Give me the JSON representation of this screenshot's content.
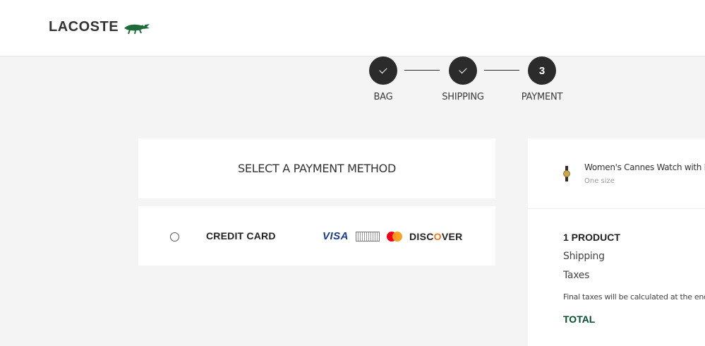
{
  "header": {
    "brand": "LACOSTE",
    "logo_icon": "crocodile-icon"
  },
  "stepper": {
    "steps": [
      {
        "label": "BAG",
        "status": "done",
        "icon": "check-icon"
      },
      {
        "label": "SHIPPING",
        "status": "done",
        "icon": "check-icon"
      },
      {
        "label": "PAYMENT",
        "status": "current",
        "number": "3"
      }
    ]
  },
  "payment": {
    "title": "SELECT A PAYMENT METHOD",
    "method_label": "CREDIT CARD",
    "cards": {
      "visa": "VISA",
      "discover_pre": "DISC",
      "discover_o": "O",
      "discover_post": "VER"
    }
  },
  "summary": {
    "item_name": "Women's Cannes Watch with Black L",
    "item_size": "One size",
    "products": "1 PRODUCT",
    "shipping": "Shipping",
    "taxes": "Taxes",
    "note": "Final taxes will be calculated at the end of t",
    "total": "TOTAL"
  },
  "colors": {
    "accent_green": "#0b4d2c",
    "step_bg": "#2b2b2b",
    "page_bg": "#f4f4f4"
  }
}
